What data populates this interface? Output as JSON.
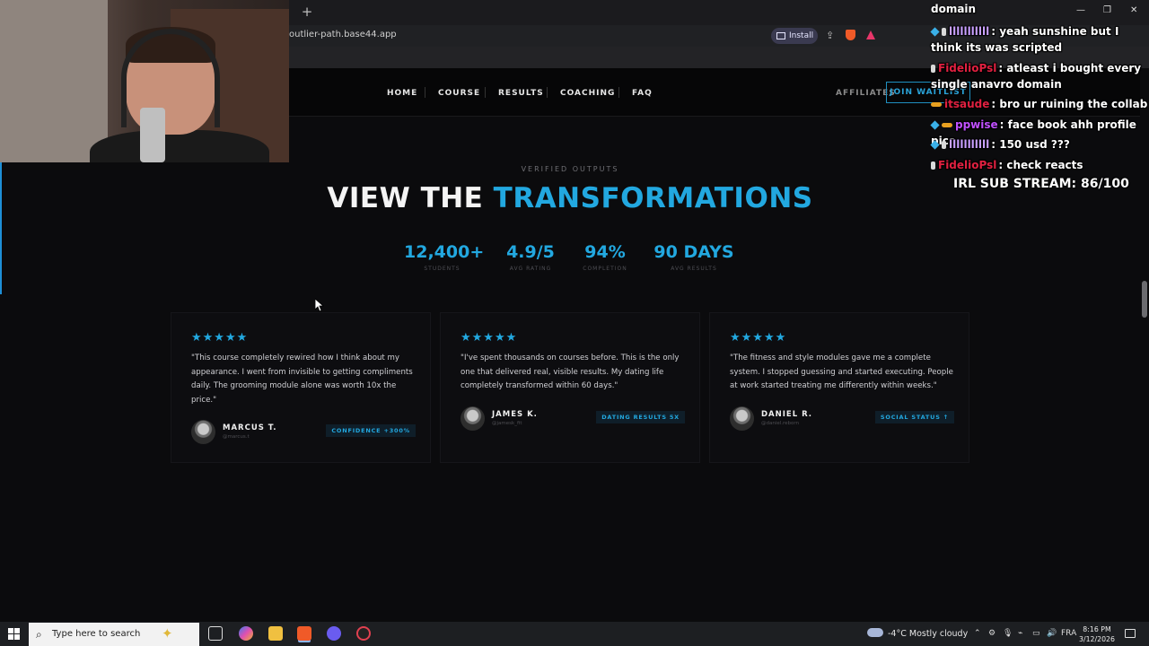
{
  "browser": {
    "new_tab": "+",
    "url": "outlier-path.base44.app",
    "install_label": "Install"
  },
  "nav": {
    "links": [
      "HOME",
      "COURSE",
      "RESULTS",
      "COACHING",
      "FAQ"
    ],
    "affiliates": "AFFILIATES",
    "cta": "JOIN WAITLIST"
  },
  "hero": {
    "eyebrow": "VERIFIED OUTPUTS",
    "headline_white": "VIEW THE",
    "headline_blue": "TRANSFORMATIONS",
    "accent": "#22a8e0"
  },
  "stats": [
    {
      "value": "12,400+",
      "label": "STUDENTS"
    },
    {
      "value": "4.9/5",
      "label": "AVG RATING"
    },
    {
      "value": "94%",
      "label": "COMPLETION"
    },
    {
      "value": "90 DAYS",
      "label": "AVG RESULTS"
    }
  ],
  "testimonials": [
    {
      "stars": "★★★★★",
      "quote": "\"This course completely rewired how I think about my appearance. I went from invisible to getting compliments daily. The grooming module alone was worth 10x the price.\"",
      "name": "MARCUS T.",
      "handle": "@marcus.t",
      "badge": "CONFIDENCE +300%"
    },
    {
      "stars": "★★★★★",
      "quote": "\"I've spent thousands on courses before. This is the only one that delivered real, visible results. My dating life completely transformed within 60 days.\"",
      "name": "JAMES K.",
      "handle": "@jamesk_fit",
      "badge": "DATING RESULTS 5X"
    },
    {
      "stars": "★★★★★",
      "quote": "\"The fitness and style modules gave me a complete system. I stopped guessing and started executing. People at work started treating me differently within weeks.\"",
      "name": "DANIEL R.",
      "handle": "@daniel.reborn",
      "badge": "SOCIAL STATUS ↑"
    }
  ],
  "overlay": {
    "chat_title": "domain",
    "messages": [
      {
        "user": "lllllllllll",
        "color": "#c8a0ff",
        "text": ": yeah sunshine but I think its was scripted"
      },
      {
        "user": "FidelioPsl",
        "color": "#e02040",
        "text": ": atleast i bought every single anavro domain"
      },
      {
        "user": "itsaude",
        "color": "#e02040",
        "text": ": bro ur ruining the collab"
      },
      {
        "user": "ppwise",
        "color": "#c050ff",
        "text": ": face book ahh profile pics"
      },
      {
        "user": "lllllllllll",
        "color": "#c8a0ff",
        "text": ": 150 usd ???"
      },
      {
        "user": "FidelioPsl",
        "color": "#e02040",
        "text": ": check reacts"
      }
    ],
    "sub_stream": "IRL SUB STREAM: 86/100"
  },
  "taskbar": {
    "search_placeholder": "Type here to search",
    "weather": "-4°C  Mostly cloudy",
    "lang": "FRA",
    "time": "8:16 PM",
    "date": "3/12/2026"
  }
}
